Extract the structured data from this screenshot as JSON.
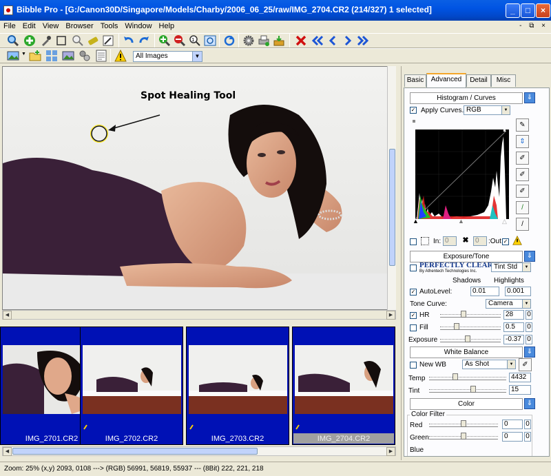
{
  "window": {
    "title": "Bibble Pro - [G:/Canon30D/Singapore/Models/Charby/2006_06_25/raw/IMG_2704.CR2 (214/327) 1 selected]",
    "minimize": "_",
    "maximize": "□",
    "close": "×"
  },
  "menu": {
    "items": [
      "File",
      "Edit",
      "View",
      "Browser",
      "Tools",
      "Window",
      "Help"
    ],
    "doc_controls": "- ⧉ ×"
  },
  "toolbar2": {
    "filter_value": "All Images"
  },
  "photo": {
    "annotation": "Spot Healing Tool"
  },
  "thumbnails": [
    {
      "name": "IMG_2701.CR2",
      "selected": false
    },
    {
      "name": "IMG_2702.CR2",
      "selected": false
    },
    {
      "name": "IMG_2703.CR2",
      "selected": false
    },
    {
      "name": "IMG_2704.CR2",
      "selected": true
    }
  ],
  "status": {
    "text": "Zoom:  25% (x,y) 2093, 0108 ---> (RGB) 56991, 56819, 55937 --- (8Bit) 222, 221, 218"
  },
  "panel": {
    "tabs": [
      "Basic",
      "Advanced",
      "Detail",
      "Misc"
    ],
    "active_tab": "Advanced",
    "histogram": {
      "title": "Histogram / Curves",
      "apply_curves_label": "Apply Curves.",
      "channel": "RGB",
      "in_label": "In:",
      "in_value": "0",
      "out_value": "0",
      "out_label": ":Out"
    },
    "exposure": {
      "title": "Exposure/Tone",
      "perfectly_clear": "PERFECTLY CLEAR",
      "perfectly_clear_by": "By Athentech Technologies Inc.",
      "tint_preset": "Tint Std",
      "shadows_label": "Shadows",
      "highlights_label": "Highlights",
      "autolevel_label": "AutoLevel:",
      "shadows_value": "0.01",
      "highlights_value": "0.001",
      "tone_curve_label": "Tone Curve:",
      "tone_curve_value": "Camera",
      "hr_label": "HR",
      "hr_value": "28",
      "hr_zero": "0",
      "fill_label": "Fill",
      "fill_value": "0.5",
      "fill_zero": "0",
      "exposure_label": "Exposure",
      "exposure_value": "-0.37",
      "exposure_zero": "0"
    },
    "white_balance": {
      "title": "White Balance",
      "new_wb_label": "New WB",
      "preset": "As Shot",
      "temp_label": "Temp",
      "temp_value": "4432",
      "tint_label": "Tint",
      "tint_value": "15"
    },
    "color": {
      "title": "Color",
      "filter_label": "Color Filter",
      "red_label": "Red",
      "red_value": "0",
      "red_zero": "0",
      "green_label": "Green",
      "green_value": "0",
      "green_zero": "0",
      "blue_label": "Blue"
    }
  }
}
